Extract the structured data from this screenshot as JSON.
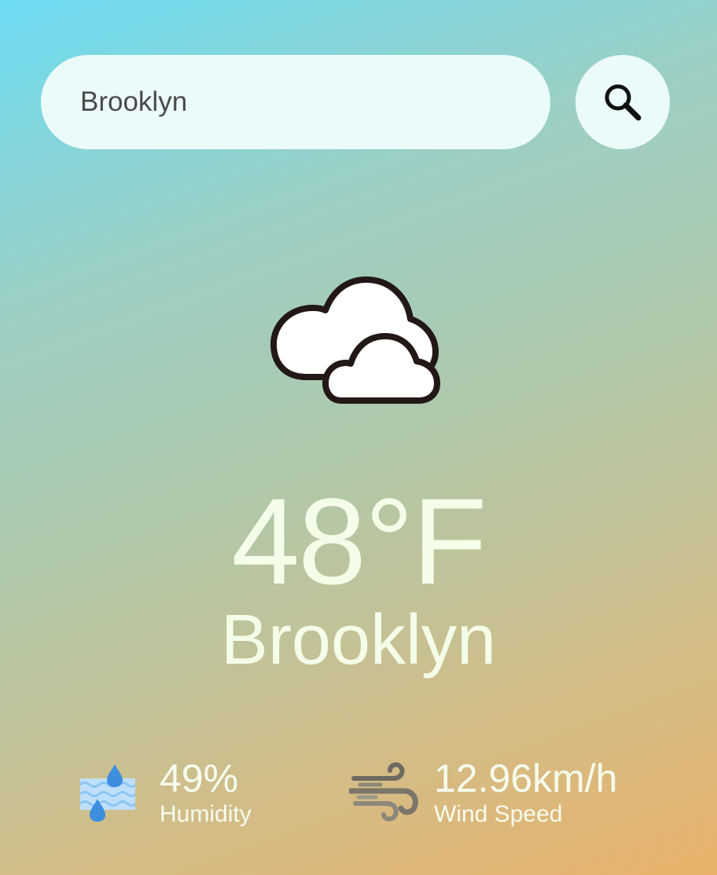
{
  "search": {
    "value": "Brooklyn",
    "placeholder": "",
    "button_icon": "search-icon"
  },
  "weather": {
    "condition_icon": "cloudy-icon",
    "temperature": "48°F",
    "city": "Brooklyn"
  },
  "details": {
    "humidity": {
      "icon": "humidity-icon",
      "value": "49%",
      "label": "Humidity"
    },
    "wind": {
      "icon": "wind-icon",
      "value": "12.96km/h",
      "label": "Wind Speed"
    }
  },
  "colors": {
    "gradient_start": "#6ddcf3",
    "gradient_end": "#e8b26a",
    "input_background": "#ebfbfa",
    "text_light": "#f4fde8"
  }
}
